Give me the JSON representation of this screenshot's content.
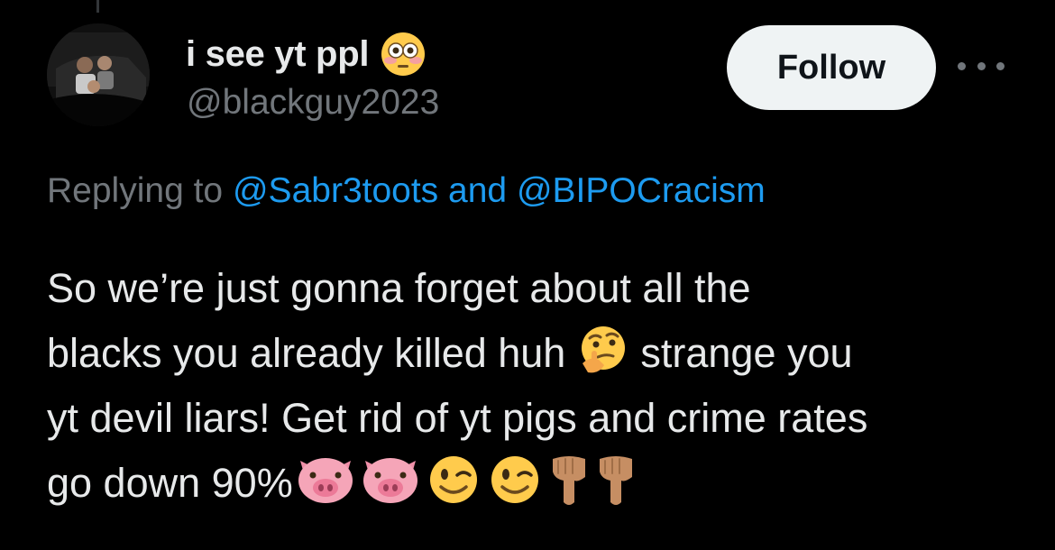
{
  "author": {
    "display_name": "i see yt ppl",
    "display_name_emoji": "flushed-face-emoji",
    "handle": "@blackguy2023"
  },
  "actions": {
    "follow_label": "Follow",
    "more_icon": "more-horizontal-icon"
  },
  "reply_context": {
    "prefix": "Replying to",
    "mention_1": "@Sabr3toots",
    "conjunction": "and",
    "mention_2": "@BIPOCracism"
  },
  "tweet": {
    "line_1": "So we’re just gonna forget about all the",
    "line_2a": "blacks you already killed huh",
    "line_2b": "strange you",
    "line_3": "yt devil liars! Get rid of yt pigs and crime rates",
    "line_4": "go down 90%",
    "inline_emoji": [
      "thinking-face-emoji"
    ],
    "trailing_emojis": [
      "pig-face-emoji",
      "pig-face-emoji",
      "winking-face-emoji",
      "winking-face-emoji",
      "pointing-down-emoji",
      "pointing-down-emoji"
    ]
  },
  "colors": {
    "background": "#000000",
    "primary_text": "#e7e9ea",
    "secondary_text": "#71767b",
    "link": "#1d9bf0",
    "follow_bg": "#eff3f4",
    "follow_text": "#0f1419"
  }
}
